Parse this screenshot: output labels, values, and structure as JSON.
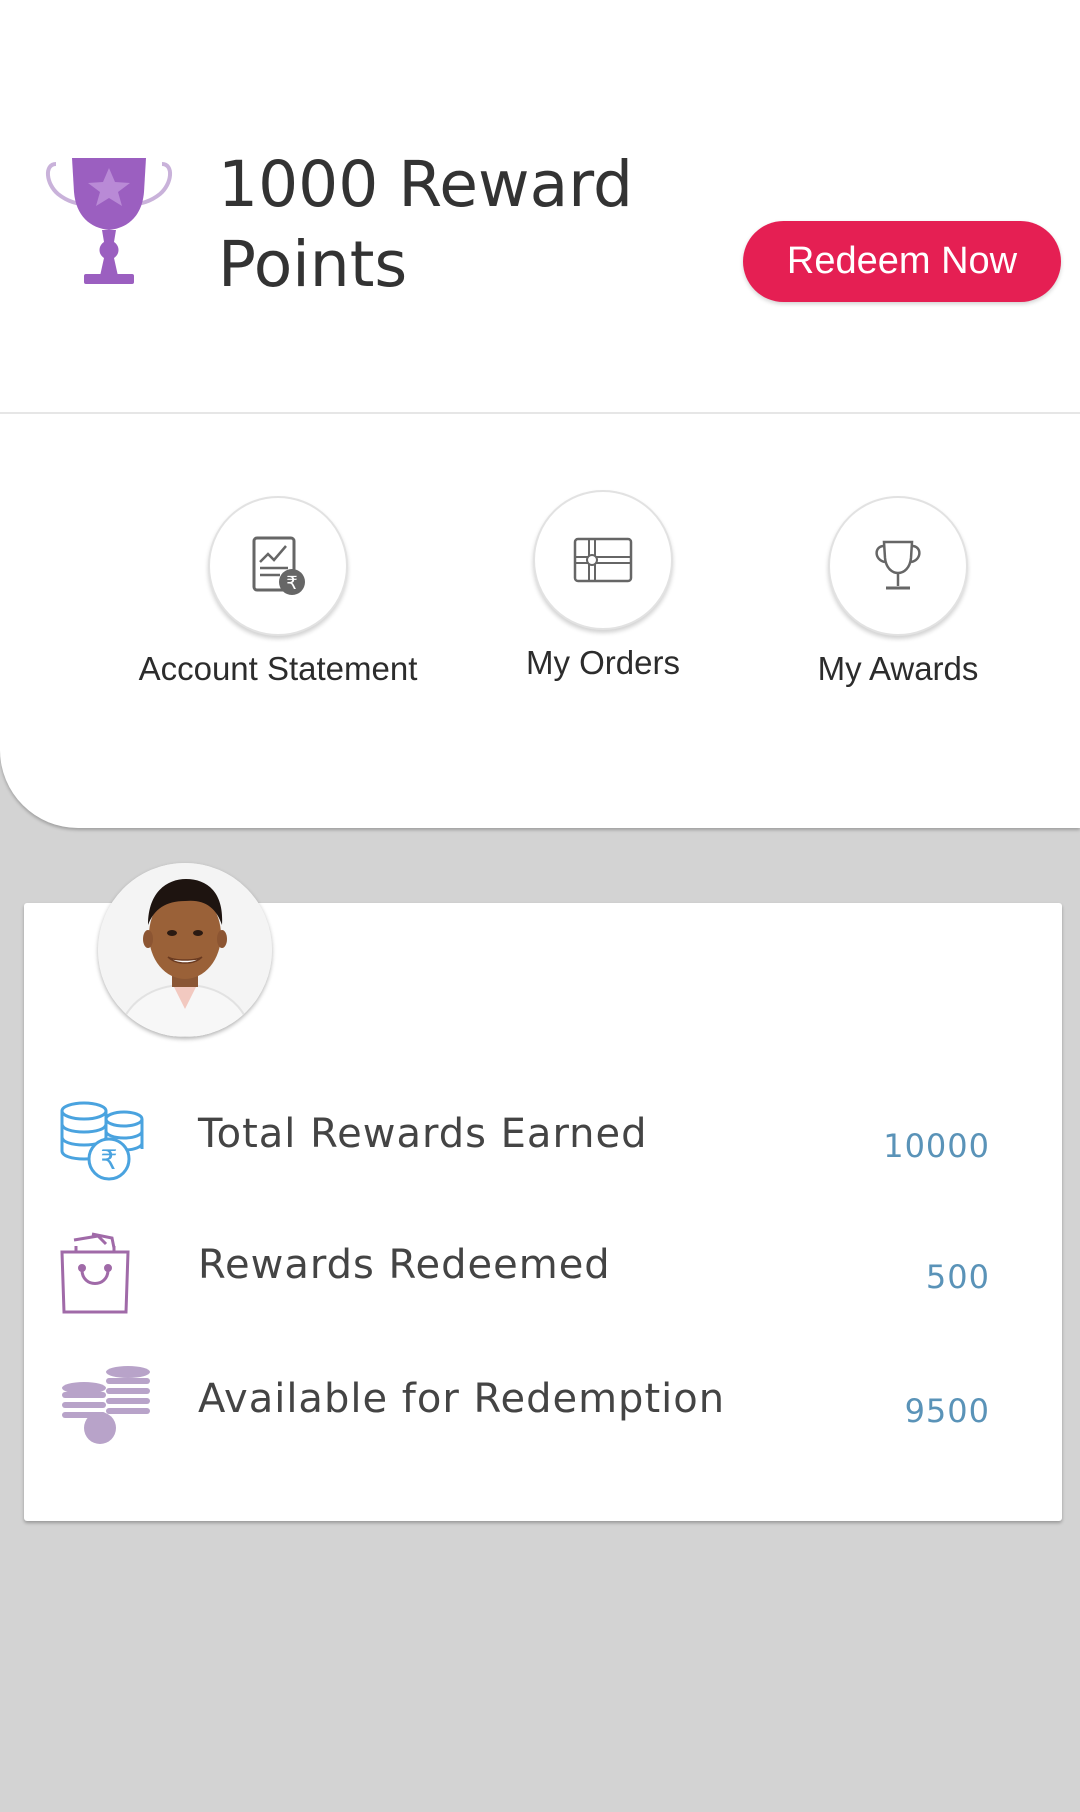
{
  "points": {
    "title": "1000 Reward Points",
    "redeem_label": "Redeem Now"
  },
  "quick_links": [
    {
      "label": "Account Statement",
      "icon": "account-statement-icon"
    },
    {
      "label": "My Orders",
      "icon": "gift-card-icon"
    },
    {
      "label": "My Awards",
      "icon": "trophy-icon"
    }
  ],
  "stats": [
    {
      "label": "Total Rewards Earned",
      "value": "10000",
      "icon": "rupee-coins-stack-icon"
    },
    {
      "label": "Rewards Redeemed",
      "value": "500",
      "icon": "shopping-bag-icon"
    },
    {
      "label": "Available for Redemption",
      "value": "9500",
      "icon": "coins-stack-icon"
    }
  ],
  "colors": {
    "accent": "#e51f53",
    "value_text": "#5a93b8",
    "trophy": "#9b5fc0",
    "stat_icon_blue": "#4aa3df",
    "stat_icon_purple": "#a06aa8",
    "background": "#d3d3d3"
  }
}
